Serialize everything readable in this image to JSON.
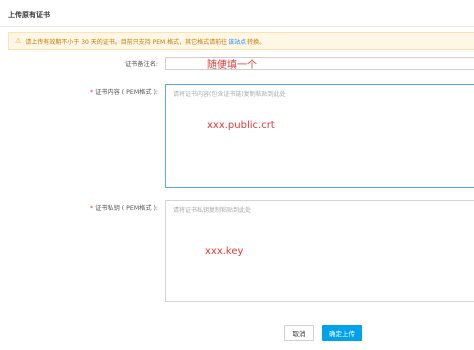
{
  "dialog": {
    "title": "上传原有证书"
  },
  "notice": {
    "icon": "warning-icon",
    "text_before": "请上传有效期不小于 30 天的证书。目前只支持 PEM 格式，其它格式请前往",
    "link_text": "该站点",
    "text_after": "转换。"
  },
  "form": {
    "name": {
      "label": "证书备注名:",
      "value": "",
      "annotation": "随便填一个"
    },
    "cert": {
      "required_mark": "*",
      "label": "证书内容 ( PEM格式 ):",
      "placeholder": "请将证书内容(包含证书链)复制粘贴到此处",
      "annotation": "xxx.public.crt"
    },
    "key": {
      "required_mark": "*",
      "label": "证书私钥 ( PEM格式 ):",
      "placeholder": "请将证书私钥复制粘贴到此处",
      "annotation": "xxx.key"
    }
  },
  "buttons": {
    "cancel": "取消",
    "confirm": "确定上传"
  },
  "colors": {
    "primary": "#00a2ea",
    "annotation_red": "#e53935",
    "notice_bg": "#fff7e6",
    "link": "#1e88e5"
  }
}
